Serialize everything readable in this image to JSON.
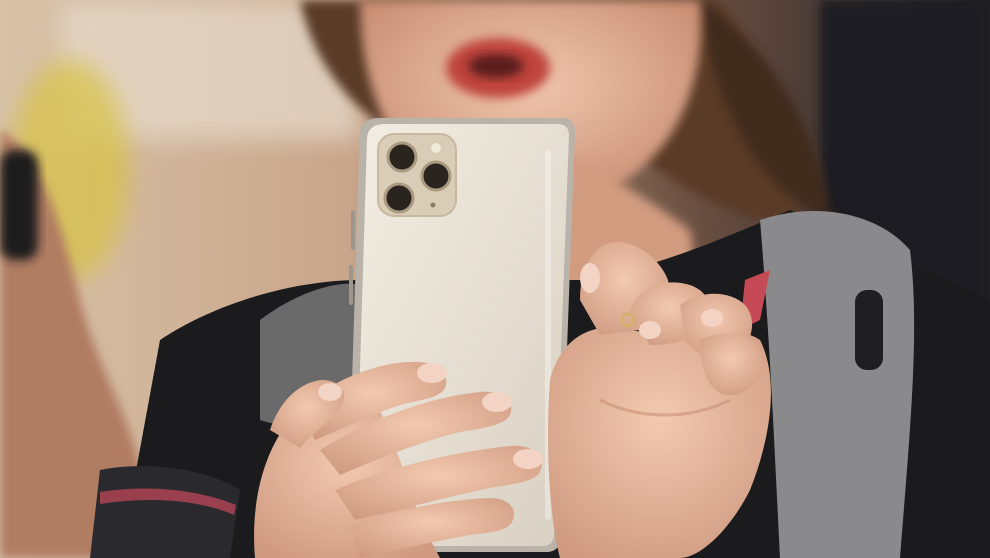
{
  "scene": {
    "colors": {
      "background_left": "#c9a58a",
      "background_right": "#1e1f26",
      "skin": "#e7b79e",
      "skin_shadow": "#c98f74",
      "hair": "#5a3a28",
      "lips": "#c0453d",
      "phone_body": "#e9e2d6",
      "phone_frame": "#b9b3aa",
      "camera_module": "#d9cdb8",
      "camera_lens": "#2a241f",
      "jacket_dark": "#1b1b1d",
      "jacket_grey": "#8a8a8c",
      "sleeve_accent": "#c64a56",
      "blur_yellow": "#d8c24a"
    }
  }
}
